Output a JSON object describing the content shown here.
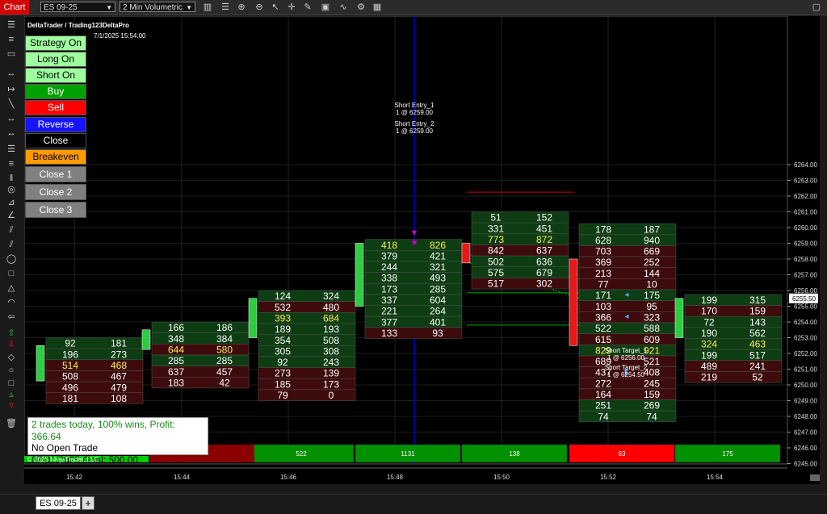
{
  "toolbar": {
    "chart_tab": "Chart",
    "instrument": "ES 09-25",
    "period": "2 Min Volumetric"
  },
  "bottom": {
    "tab": "ES 09-25",
    "add": "+"
  },
  "header": {
    "account": "DeltaTrader / Trading123DeltaPro",
    "datetime": "7/1/2025 15:54:00"
  },
  "buttons": {
    "strategy": "Strategy On",
    "long": "Long On",
    "short": "Short On",
    "buy": "Buy",
    "sell": "Sell",
    "reverse": "Reverse",
    "close": "Close",
    "breakeven": "Breakeven",
    "close1": "Close 1",
    "close2": "Close 2",
    "close3": "Close 3"
  },
  "stats": {
    "line1": "2 trades today, 100% wins, Profit: 366.64",
    "line2": "No Open Trade",
    "line3": "07/01/2025 Goal: 500.00"
  },
  "copyright": "© 2025 NinjaTrader, LLC",
  "colors": {
    "bg": "#000000",
    "grid": "#3a3a3a",
    "bull": "#2ecc40",
    "bear": "#e51919",
    "cell_green": "#0e3d13",
    "cell_red": "#3d0b0b",
    "highlight": "#ffee55",
    "cursor": "#0000ff",
    "price_box": "#ffffff"
  },
  "chart_data": {
    "type": "footprint",
    "ylim": [
      6244.75,
      6264.75
    ],
    "y_ticks": [
      "6264.00",
      "6263.00",
      "6262.00",
      "6261.00",
      "6260.00",
      "6259.00",
      "6258.00",
      "6257.00",
      "6256.00",
      "6255.00",
      "6254.00",
      "6253.00",
      "6252.00",
      "6251.00",
      "6250.00",
      "6249.00",
      "6248.00",
      "6247.00",
      "6246.00",
      "6245.00"
    ],
    "x_ticks": [
      "15:42",
      "15:44",
      "15:46",
      "15:48",
      "15:50",
      "15:52",
      "15:54"
    ],
    "current_price": "6255.50",
    "bars": [
      {
        "dir": "up",
        "open": 6250.25,
        "close": 6252.5,
        "top": 6253.0,
        "rows": [
          [
            "92",
            "181"
          ],
          [
            "196",
            "273"
          ],
          [
            "514",
            "468"
          ],
          [
            "508",
            "467"
          ],
          [
            "496",
            "479"
          ],
          [
            "181",
            "108"
          ]
        ],
        "hl": 2,
        "delta": ""
      },
      {
        "dir": "up",
        "open": 6252.25,
        "close": 6253.5,
        "top": 6254.0,
        "rows": [
          [
            "166",
            "186"
          ],
          [
            "348",
            "384"
          ],
          [
            "644",
            "580"
          ],
          [
            "285",
            "285"
          ],
          [
            "637",
            "457"
          ],
          [
            "183",
            "42"
          ]
        ],
        "hl": 2,
        "delta": ""
      },
      {
        "dir": "up",
        "open": 6253.0,
        "close": 6255.5,
        "top": 6256.0,
        "rows": [
          [
            "124",
            "324"
          ],
          [
            "532",
            "480"
          ],
          [
            "393",
            "684"
          ],
          [
            "189",
            "193"
          ],
          [
            "354",
            "508"
          ],
          [
            "305",
            "308"
          ],
          [
            "92",
            "243"
          ],
          [
            "273",
            "139"
          ],
          [
            "185",
            "173"
          ],
          [
            "79",
            "0"
          ]
        ],
        "hl": 2,
        "delta": "522"
      },
      {
        "dir": "up",
        "open": 6255.0,
        "close": 6259.0,
        "top": 6259.25,
        "rows": [
          [
            "418",
            "826"
          ],
          [
            "379",
            "421"
          ],
          [
            "244",
            "321"
          ],
          [
            "338",
            "493"
          ],
          [
            "173",
            "285"
          ],
          [
            "337",
            "604"
          ],
          [
            "221",
            "264"
          ],
          [
            "377",
            "401"
          ],
          [
            "133",
            "93"
          ]
        ],
        "hl": 0,
        "delta": "1131"
      },
      {
        "dir": "down",
        "open": 6259.0,
        "close": 6257.75,
        "top": 6261.0,
        "rows": [
          [
            "51",
            "152"
          ],
          [
            "331",
            "451"
          ],
          [
            "773",
            "872"
          ],
          [
            "842",
            "637"
          ],
          [
            "502",
            "636"
          ],
          [
            "575",
            "679"
          ],
          [
            "517",
            "302"
          ]
        ],
        "hl": 2,
        "delta": "138"
      },
      {
        "dir": "down",
        "open": 6258.0,
        "close": 6252.5,
        "top": 6260.25,
        "rows": [
          [
            "178",
            "187"
          ],
          [
            "628",
            "940"
          ],
          [
            "703",
            "669"
          ],
          [
            "369",
            "252"
          ],
          [
            "213",
            "144"
          ],
          [
            "77",
            "10"
          ],
          [
            "171",
            "175"
          ],
          [
            "103",
            "95"
          ],
          [
            "366",
            "323"
          ],
          [
            "522",
            "588"
          ],
          [
            "615",
            "609"
          ],
          [
            "829",
            "921"
          ],
          [
            "689",
            "521"
          ],
          [
            "437",
            "408"
          ],
          [
            "272",
            "245"
          ],
          [
            "164",
            "159"
          ],
          [
            "251",
            "269"
          ],
          [
            "74",
            "74"
          ]
        ],
        "hl": 11,
        "delta": "63"
      },
      {
        "dir": "up",
        "open": 6253.0,
        "close": 6255.5,
        "top": 6255.75,
        "rows": [
          [
            "199",
            "315"
          ],
          [
            "170",
            "159"
          ],
          [
            "72",
            "143"
          ],
          [
            "190",
            "562"
          ],
          [
            "324",
            "463"
          ],
          [
            "199",
            "517"
          ],
          [
            "489",
            "241"
          ],
          [
            "219",
            "52"
          ]
        ],
        "hl": 4,
        "delta": "175"
      }
    ],
    "delta_first": {
      "label": "",
      "kind": [
        "green",
        "red"
      ]
    },
    "annotations": [
      {
        "text": "Short Entry_1",
        "sub": "1 @ 6259.00"
      },
      {
        "text": "Short Entry_2",
        "sub": "1 @ 6259.00"
      },
      {
        "text": "Short Target_1",
        "sub": "1 @ 6256.00"
      },
      {
        "text": "Short Target_2",
        "sub": "1 @ 6254.50"
      }
    ]
  }
}
